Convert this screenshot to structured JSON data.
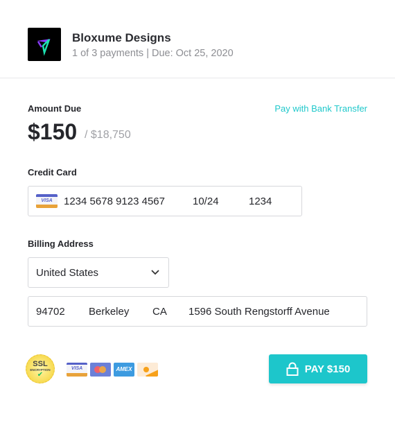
{
  "merchant": {
    "name": "Bloxume Designs",
    "subtitle": "1 of 3 payments | Due: Oct 25, 2020"
  },
  "amount": {
    "label": "Amount Due",
    "value": "$150",
    "total": "/ $18,750",
    "bank_link": "Pay with Bank Transfer"
  },
  "credit_card": {
    "label": "Credit Card",
    "number": "1234 5678 9123 4567",
    "expiry": "10/24",
    "cvc": "1234",
    "card_brand": "VISA"
  },
  "billing": {
    "label": "Billing Address",
    "country": "United States",
    "zip": "94702",
    "city": "Berkeley",
    "state": "CA",
    "street": "1596 South Rengstorff Avenue"
  },
  "badges": {
    "ssl_top": "SSL",
    "ssl_bottom": "ENCRYPTION",
    "visa": "VISA",
    "amex": "AMEX"
  },
  "pay_button": {
    "label": "PAY $150"
  },
  "colors": {
    "accent": "#1dc6cb"
  }
}
